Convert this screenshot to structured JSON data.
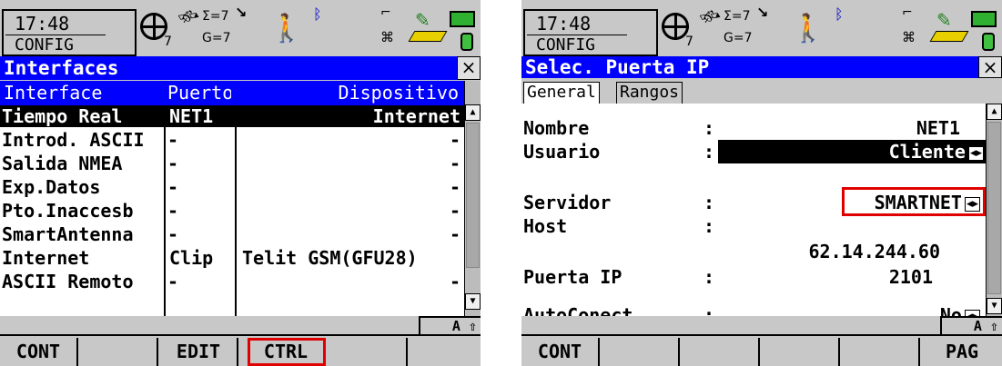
{
  "left": {
    "status": {
      "time": "17:48",
      "mode": "CONFIG",
      "sats_a": "Σ=7",
      "sats_b": "G=7",
      "sats_c": "7"
    },
    "title": "Interfaces",
    "close": "×",
    "columns": [
      "Interface",
      "Puerto",
      "Dispositivo"
    ],
    "rows": [
      {
        "interface": "Tiempo Real",
        "port": "NET1",
        "device": "Internet"
      },
      {
        "interface": "Introd. ASCII",
        "port": "-",
        "device": "-"
      },
      {
        "interface": "Salida NMEA",
        "port": "-",
        "device": "-"
      },
      {
        "interface": "Exp.Datos",
        "port": "-",
        "device": "-"
      },
      {
        "interface": "Pto.Inaccesb",
        "port": "-",
        "device": "-"
      },
      {
        "interface": "SmartAntenna",
        "port": "-",
        "device": "-"
      },
      {
        "interface": "Internet",
        "port": "Clip",
        "device": "Telit GSM(GFU28)"
      },
      {
        "interface": "ASCII Remoto",
        "port": "-",
        "device": "-"
      }
    ],
    "shift": "A ⇧",
    "softkeys": [
      "CONT",
      "",
      "EDIT",
      "CTRL",
      "",
      ""
    ]
  },
  "right": {
    "status": {
      "time": "17:48",
      "mode": "CONFIG",
      "sats_a": "Σ=7",
      "sats_b": "G=7",
      "sats_c": "7"
    },
    "title": "Selec. Puerta IP",
    "close": "×",
    "tabs": [
      "General",
      "Rangos"
    ],
    "fields": {
      "nombre": {
        "label": "Nombre",
        "sep": ":",
        "value": "NET1"
      },
      "usuario": {
        "label": "Usuario",
        "sep": ":",
        "value": "Cliente"
      },
      "servidor": {
        "label": "Servidor",
        "sep": ":",
        "value": "SMARTNET"
      },
      "host": {
        "label": "Host",
        "sep": ":",
        "value": "62.14.244.60"
      },
      "puerta": {
        "label": "Puerta IP",
        "sep": ":",
        "value": "2101"
      },
      "autoconect": {
        "label": "AutoConect",
        "sep": ":",
        "value": "No"
      }
    },
    "shift": "A ⇧",
    "softkeys": [
      "CONT",
      "",
      "",
      "",
      "",
      "PAG"
    ]
  },
  "icons": [
    "target-icon",
    "satellite-icon",
    "walking-person-icon",
    "bluetooth-icon",
    "network-icon",
    "pen-icon",
    "battery-icon",
    "memory-card-icon"
  ],
  "colors": {
    "titlebar": "#0000ff",
    "screen": "#c8c8c8",
    "highlight": "#e00000"
  }
}
